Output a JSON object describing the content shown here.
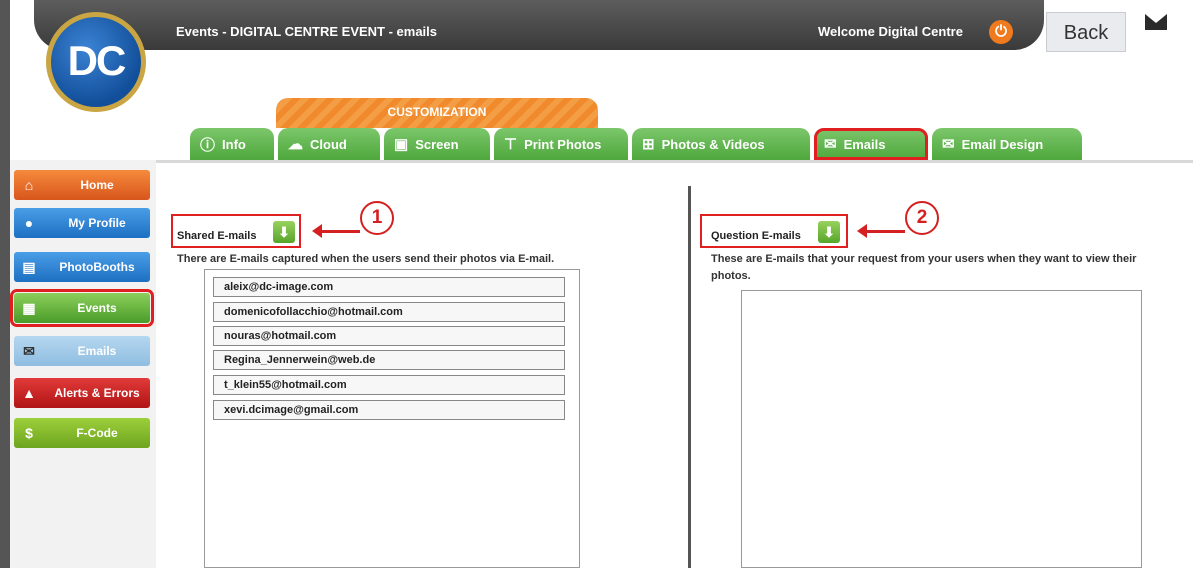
{
  "header": {
    "title": "Events - DIGITAL CENTRE EVENT - emails",
    "welcome": "Welcome Digital Centre",
    "back_label": "Back",
    "logo_text": "DC"
  },
  "tabs": {
    "group_label": "CUSTOMIZATION",
    "items": [
      {
        "label": "Info",
        "icon": "info-icon"
      },
      {
        "label": "Cloud",
        "icon": "cloud-icon"
      },
      {
        "label": "Screen",
        "icon": "screen-icon"
      },
      {
        "label": "Print Photos",
        "icon": "print-icon"
      },
      {
        "label": "Photos & Videos",
        "icon": "photos-videos-icon"
      },
      {
        "label": "Emails",
        "icon": "mail-icon",
        "active": true
      },
      {
        "label": "Email Design",
        "icon": "email-design-icon"
      }
    ]
  },
  "sidebar": {
    "items": [
      {
        "label": "Home",
        "icon": "home-icon"
      },
      {
        "label": "My Profile",
        "icon": "profile-icon"
      },
      {
        "label": "PhotoBooths",
        "icon": "photobooths-icon"
      },
      {
        "label": "Events",
        "icon": "calendar-icon",
        "active": true
      },
      {
        "label": "Emails",
        "icon": "mail-icon"
      },
      {
        "label": "Alerts & Errors",
        "icon": "alert-icon"
      },
      {
        "label": "F-Code",
        "icon": "fcode-icon"
      }
    ]
  },
  "shared": {
    "label": "Shared E-mails",
    "description": "There are E-mails captured when the users send their photos via E-mail.",
    "callout_number": "1",
    "emails": [
      "aleix@dc-image.com",
      "domenicofollacchio@hotmail.com",
      "nouras@hotmail.com",
      "Regina_Jennerwein@web.de",
      "t_klein55@hotmail.com",
      "xevi.dcimage@gmail.com"
    ]
  },
  "question": {
    "label": "Question E-mails",
    "description_line1": "These are E-mails that your request from your users when they want to view their",
    "description_line2": "photos.",
    "callout_number": "2"
  },
  "colors": {
    "tab_green": "#4ea83c",
    "customization_orange": "#f08a2c",
    "highlight_red": "#e02020",
    "download_green": "#58a52a"
  }
}
